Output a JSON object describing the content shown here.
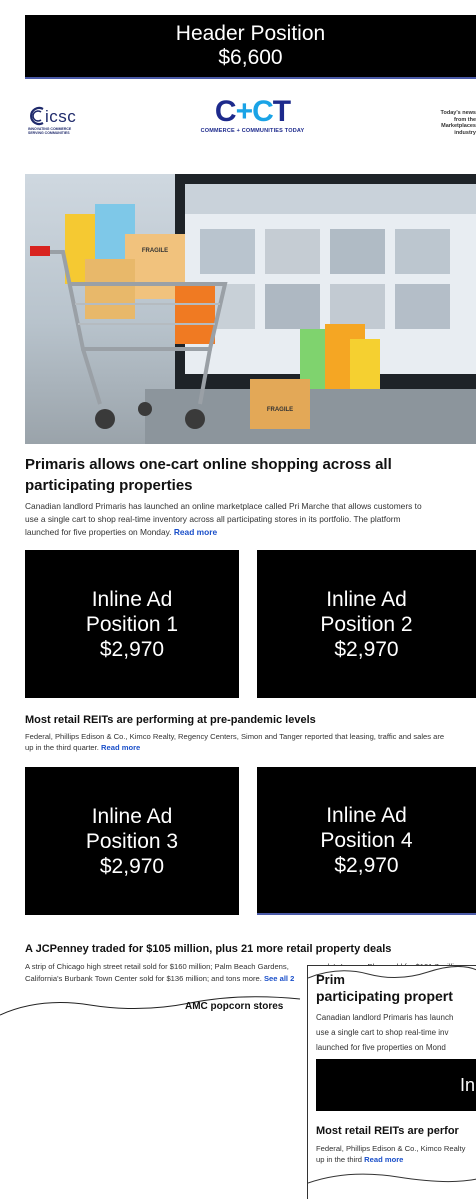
{
  "header_ad": {
    "line1": "Header Position",
    "line2": "$6,600"
  },
  "logos": {
    "icsc": "icsc",
    "icsc_sub1": "INNOVATING COMMERCE",
    "icsc_sub2": "SERVING COMMUNITIES",
    "cct_main": "C+CT",
    "cct_tagline": "COMMERCE + COMMUNITIES TODAY",
    "today_line1": "Today's news",
    "today_line2": "from the",
    "today_line3": "Marketplaces",
    "today_line4": "industry"
  },
  "hero_image": {
    "label1": "FRAGILE",
    "label2": "FRAGILE"
  },
  "article1": {
    "title_line1": "Primaris allows one-cart online shopping across all",
    "title_line2": "participating properties",
    "body_line1": "Canadian landlord Primaris has launched an online marketplace called Pri Marche that allows customers to",
    "body_line2": "use a single cart to shop real-time inventory across all participating stores in its portfolio. The platform",
    "body_line3": "launched for five properties on Monday.",
    "read_more": "Read more"
  },
  "inline_ads": [
    {
      "l1": "Inline Ad",
      "l2": "Position 1",
      "l3": "$2,970"
    },
    {
      "l1": "Inline Ad",
      "l2": "Position 2",
      "l3": "$2,970"
    },
    {
      "l1": "Inline Ad",
      "l2": "Position 3",
      "l3": "$2,970"
    },
    {
      "l1": "Inline Ad",
      "l2": "Position 4",
      "l3": "$2,970"
    }
  ],
  "article2": {
    "title": "Most retail REITs are performing at pre-pandemic levels",
    "body_line1": "Federal, Phillips Edison & Co., Kimco Realty, Regency Centers, Simon and Tanger reported that leasing, traffic and sales are",
    "body_line2": "up in the third quarter.",
    "read_more": "Read more"
  },
  "article3": {
    "title": "A JCPenney traded for $105 million, plus 21 more retail property deals",
    "body_line1": "A strip of Chicago high street retail sold for $160 million; Palm Beach Gardens,",
    "body_line1b": "da's Legacy Place sold for $101.7 million;",
    "body_line2": "California's Burbank Town Center sold for $136 million; and tons more.",
    "see_all": "See all 2",
    "next_title": "AMC popcorn stores"
  },
  "zoom_inset": {
    "cut_title": "Prim",
    "title": "participating propert",
    "body_line1": "Canadian landlord Primaris has launch",
    "body_line2": "use a single cart to shop real-time inv",
    "body_line3": "launched for five properties on Mond",
    "ad_text": "In",
    "h2": "Most retail REITs are perfor",
    "body2_line1": "Federal, Phillips Edison & Co., Kimco Realty",
    "body2_line2": "up in the third",
    "read_more": "Read more"
  }
}
